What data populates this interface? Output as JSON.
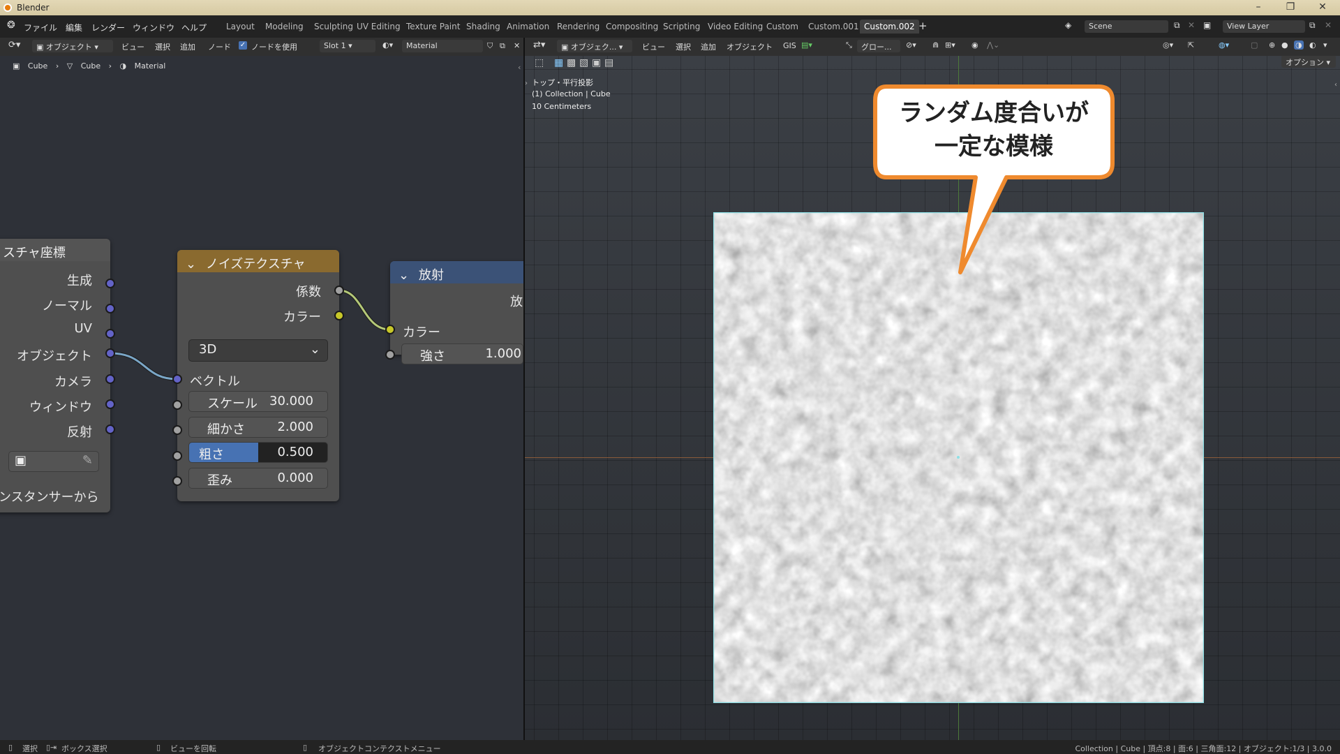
{
  "window": {
    "title": "Blender"
  },
  "menu": [
    "ファイル",
    "編集",
    "レンダー",
    "ウィンドウ",
    "ヘルプ"
  ],
  "workspaces": [
    "Layout",
    "Modeling",
    "Sculpting",
    "UV Editing",
    "Texture Paint",
    "Shading",
    "Animation",
    "Rendering",
    "Compositing",
    "Scripting",
    "Video Editing",
    "Custom",
    "Custom.001",
    "Custom.002"
  ],
  "active_workspace": "Custom.002",
  "scene": "Scene",
  "view_layer": "View Layer",
  "node_header": {
    "mode": "オブジェクト",
    "items": [
      "ビュー",
      "選択",
      "追加",
      "ノード"
    ],
    "use_nodes": "ノードを使用",
    "slot": "Slot 1",
    "material": "Material"
  },
  "breadcrumb": [
    "Cube",
    "Cube",
    "Material"
  ],
  "nodes": {
    "texcoord": {
      "title": "スチャ座標",
      "outputs": [
        "生成",
        "ノーマル",
        "UV",
        "オブジェクト",
        "カメラ",
        "ウィンドウ",
        "反射"
      ],
      "instancer": "ンスタンサーから"
    },
    "noise": {
      "title": "ノイズテクスチャ",
      "outputs": [
        "係数",
        "カラー"
      ],
      "dimension": "3D",
      "vector": "ベクトル",
      "fields": [
        {
          "label": "スケール",
          "value": "30.000"
        },
        {
          "label": "細かさ",
          "value": "2.000"
        },
        {
          "label": "粗さ",
          "value": "0.500"
        },
        {
          "label": "歪み",
          "value": "0.000"
        }
      ],
      "roughness_fill": 0.5
    },
    "emission": {
      "title": "放射",
      "output_partial": "放",
      "inputs": [
        "カラー"
      ],
      "strength": {
        "label": "強さ",
        "value": "1.000"
      }
    }
  },
  "viewport_header": {
    "mode": "オブジェク...",
    "items": [
      "ビュー",
      "選択",
      "追加",
      "オブジェクト",
      "GIS"
    ],
    "transform": "グロー...",
    "options": "オプション"
  },
  "viewport_info": [
    "トップ・平行投影",
    "(1) Collection | Cube",
    "10 Centimeters"
  ],
  "callout": {
    "line1": "ランダム度合いが",
    "line2": "一定な模様"
  },
  "statusbar": {
    "items": [
      "選択",
      "ボックス選択",
      "ビューを回転",
      "オブジェクトコンテクストメニュー"
    ],
    "right": "Collection | Cube | 頂点:8 | 面:6 | 三角面:12 | オブジェクト:1/3 | 3.0.0"
  },
  "colors": {
    "accent": "#e87d0d",
    "socket_vector": "#6363c7",
    "socket_color": "#c7c729",
    "socket_float": "#a1a1a1",
    "noise_header": "#8a6a2f",
    "emission_header": "#3b5277"
  }
}
